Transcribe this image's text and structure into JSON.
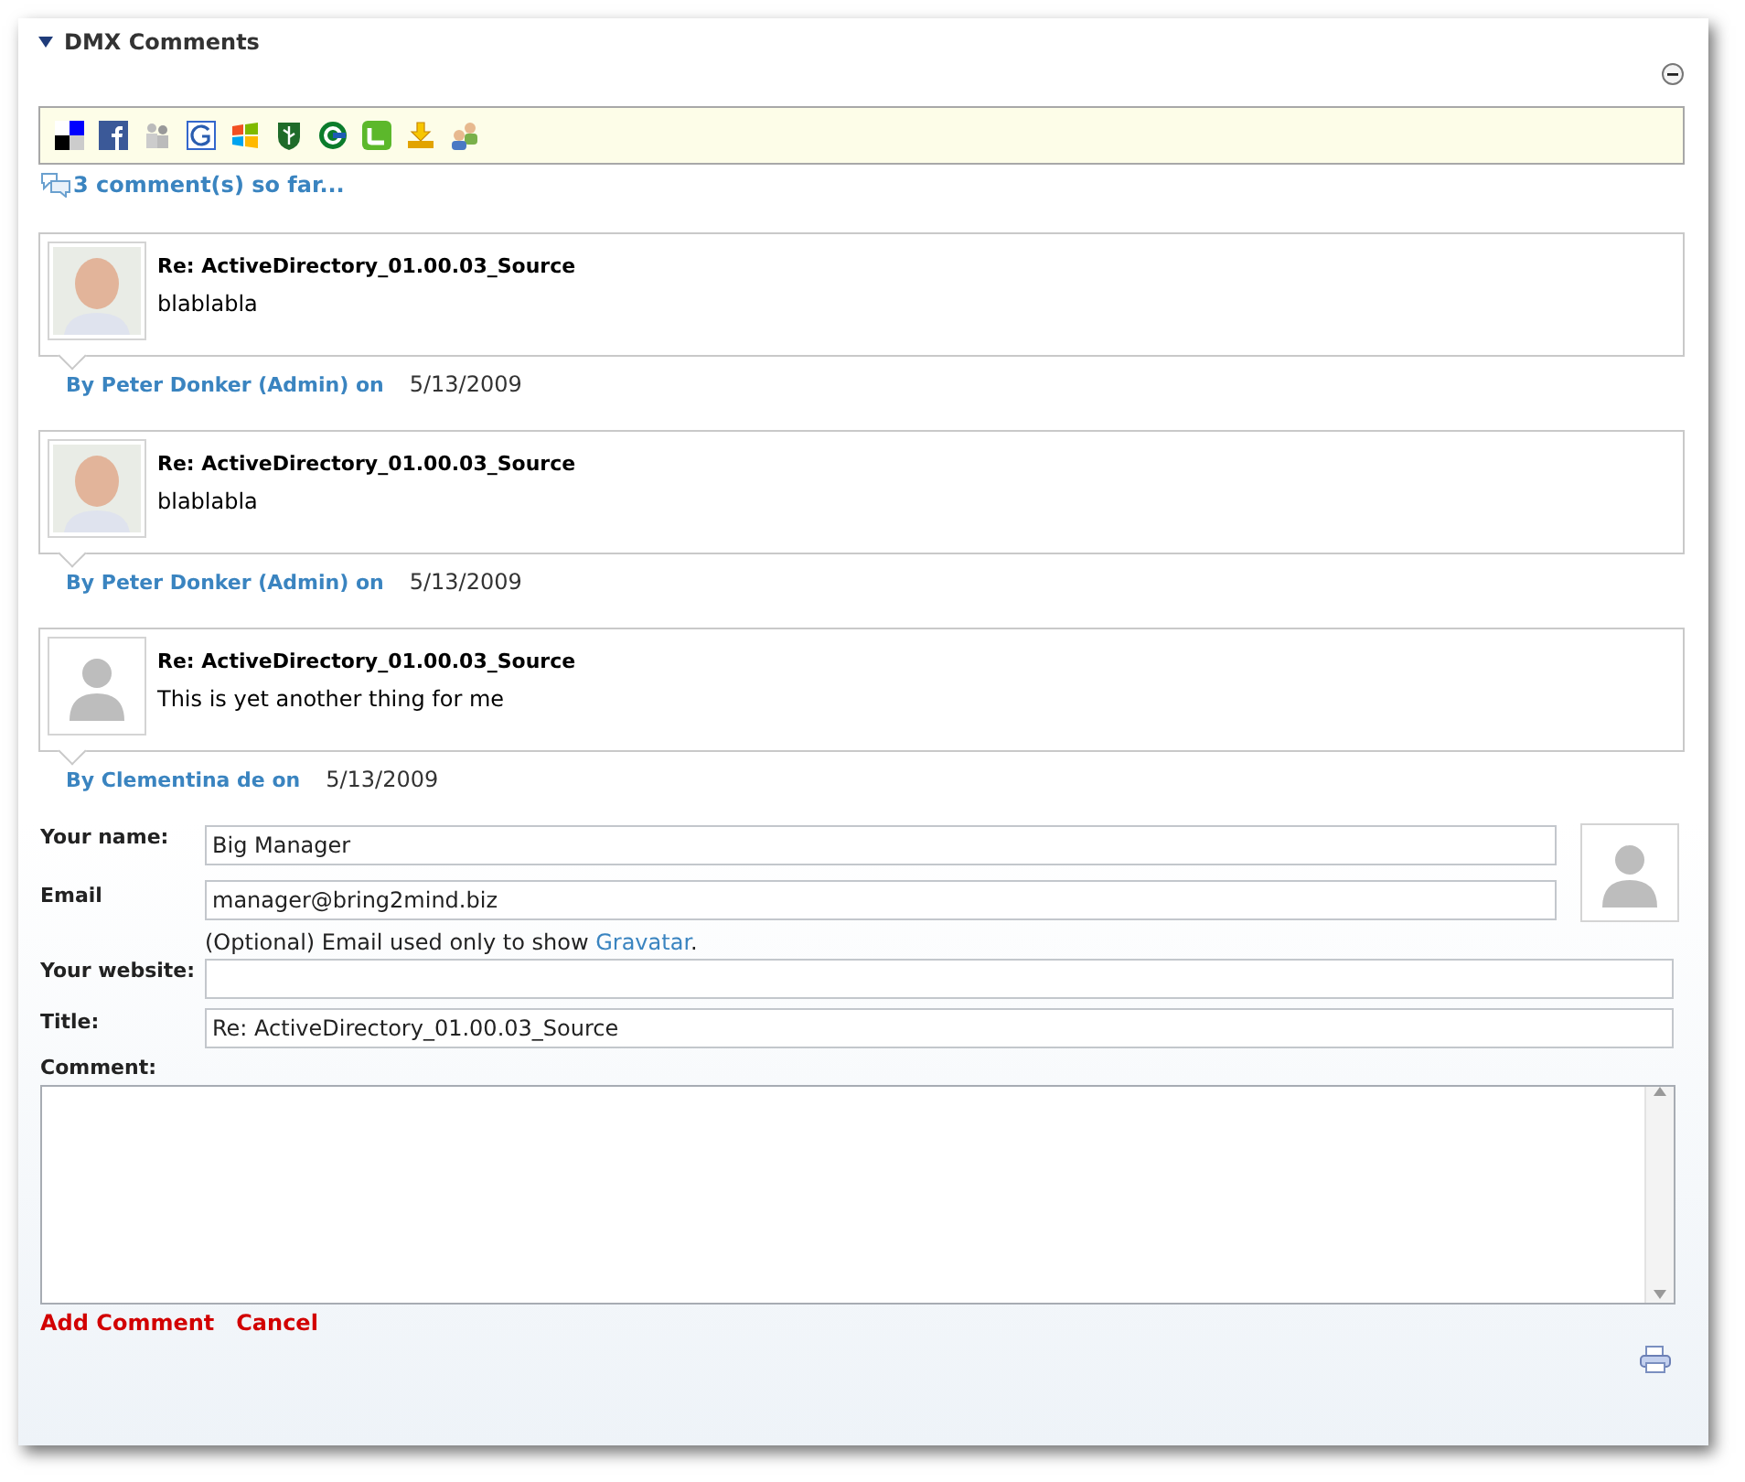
{
  "module": {
    "title": "DMX Comments",
    "expanded": true
  },
  "count_link": "3 comment(s) so far...",
  "comments": [
    {
      "title": "Re: ActiveDirectory_01.00.03_Source",
      "body": "blablabla",
      "author": "By Peter Donker (Admin) on",
      "date": "5/13/2009",
      "kind": "photo"
    },
    {
      "title": "Re: ActiveDirectory_01.00.03_Source",
      "body": "blablabla",
      "author": "By Peter Donker (Admin) on",
      "date": "5/13/2009",
      "kind": "photo"
    },
    {
      "title": "Re: ActiveDirectory_01.00.03_Source",
      "body": "This is yet another thing for me",
      "author": "By Clementina de on",
      "date": "5/13/2009",
      "kind": "default"
    }
  ],
  "form": {
    "name_label": "Your name:",
    "name_value": "Big Manager",
    "email_label": "Email",
    "email_value": "manager@bring2mind.biz",
    "email_note": "(Optional) Email used only to show ",
    "email_note_link": "Gravatar",
    "email_note_end": ".",
    "website_label": "Your website:",
    "title_label": "Title:",
    "title_value": "Re: ActiveDirectory_01.00.03_Source",
    "comment_label": "Comment:"
  },
  "actions": [
    "Add Comment",
    "Cancel"
  ]
}
